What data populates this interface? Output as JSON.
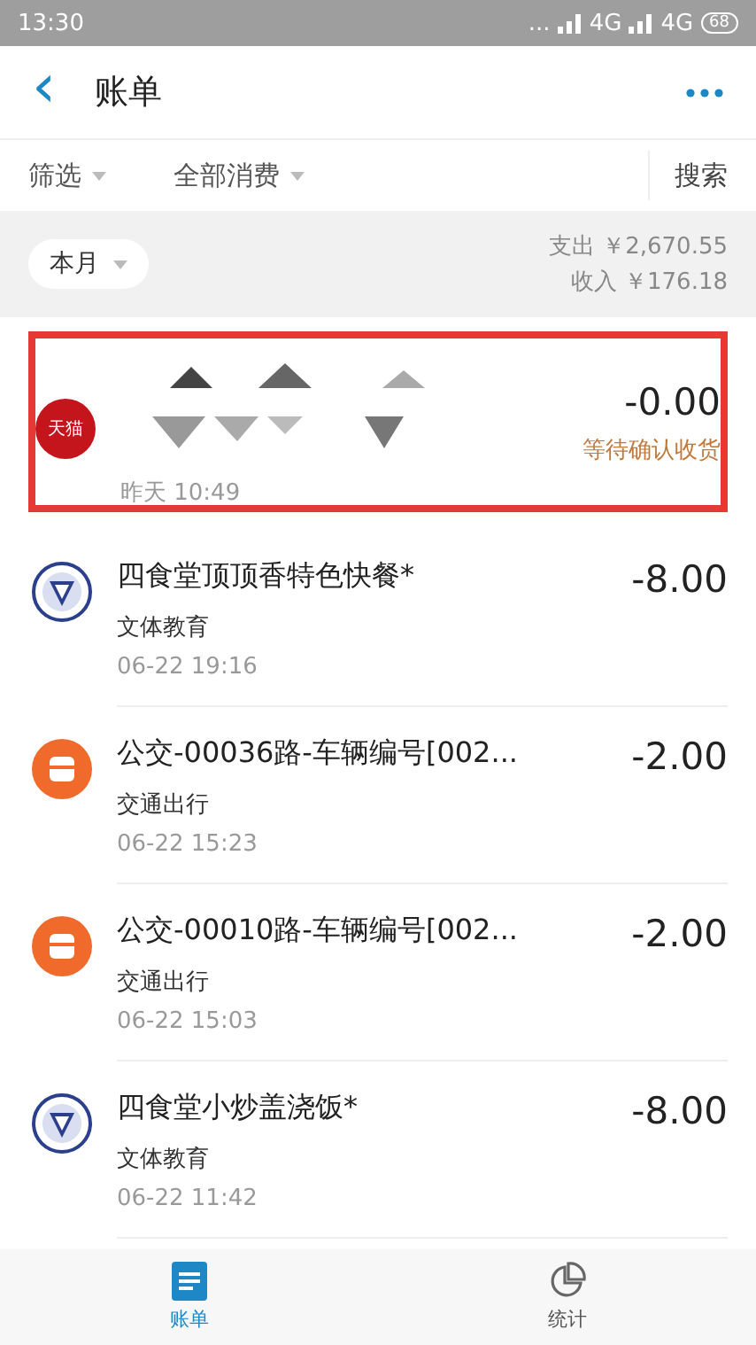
{
  "status_bar": {
    "time": "13:30",
    "dots": "...",
    "network_1": "4G",
    "network_2": "4G",
    "battery": "68"
  },
  "header": {
    "back": "‹",
    "title": "账单"
  },
  "filters": [
    {
      "label": "筛选"
    },
    {
      "label": "全部消费"
    }
  ],
  "search": "搜索",
  "month": {
    "label": "本月",
    "expense": "支出 ￥2,670.55",
    "income": "收入 ￥176.18"
  },
  "transactions": [
    {
      "kind": "store",
      "logo_text": "天猫",
      "amount": "-0.00",
      "status": "等待确认收货",
      "time": "昨天 10:49",
      "highlighted": true,
      "redacted": true
    },
    {
      "kind": "school",
      "title": "四食堂顶顶香特色快餐*",
      "category": "文体教育",
      "amount": "-8.00",
      "time": "06-22 19:16",
      "highlighted": false
    },
    {
      "kind": "bus",
      "title": "公交-00036路-车辆编号[002...",
      "category": "交通出行",
      "amount": "-2.00",
      "time": "06-22 15:23",
      "highlighted": false
    },
    {
      "kind": "bus",
      "title": "公交-00010路-车辆编号[002...",
      "category": "交通出行",
      "amount": "-2.00",
      "time": "06-22 15:03",
      "highlighted": false
    },
    {
      "kind": "school",
      "title": "四食堂小炒盖浇饭*",
      "category": "文体教育",
      "amount": "-8.00",
      "time": "06-22 11:42",
      "highlighted": false
    }
  ],
  "bottom_nav": [
    {
      "label": "账单",
      "kind": "list",
      "selected": true
    },
    {
      "label": "统计",
      "kind": "pie",
      "selected": false
    }
  ]
}
